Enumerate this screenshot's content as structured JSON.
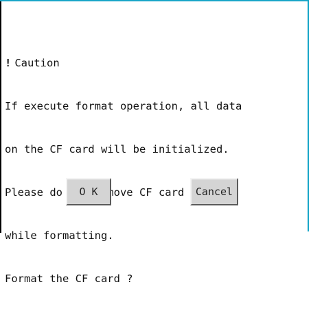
{
  "dialog": {
    "title": "Caution",
    "lines": [
      "If execute format operation, all data",
      "on the CF card will be initialized.",
      "Please do not remove CF card",
      "while formatting.",
      "Format the CF card ?"
    ]
  },
  "buttons": {
    "ok_label": "O K",
    "cancel_label": "Cancel"
  },
  "colors": {
    "frame_accent": "#19a6c8",
    "button_face": "#d4d4d4"
  },
  "icons": {
    "caution": "exclamation-icon"
  }
}
